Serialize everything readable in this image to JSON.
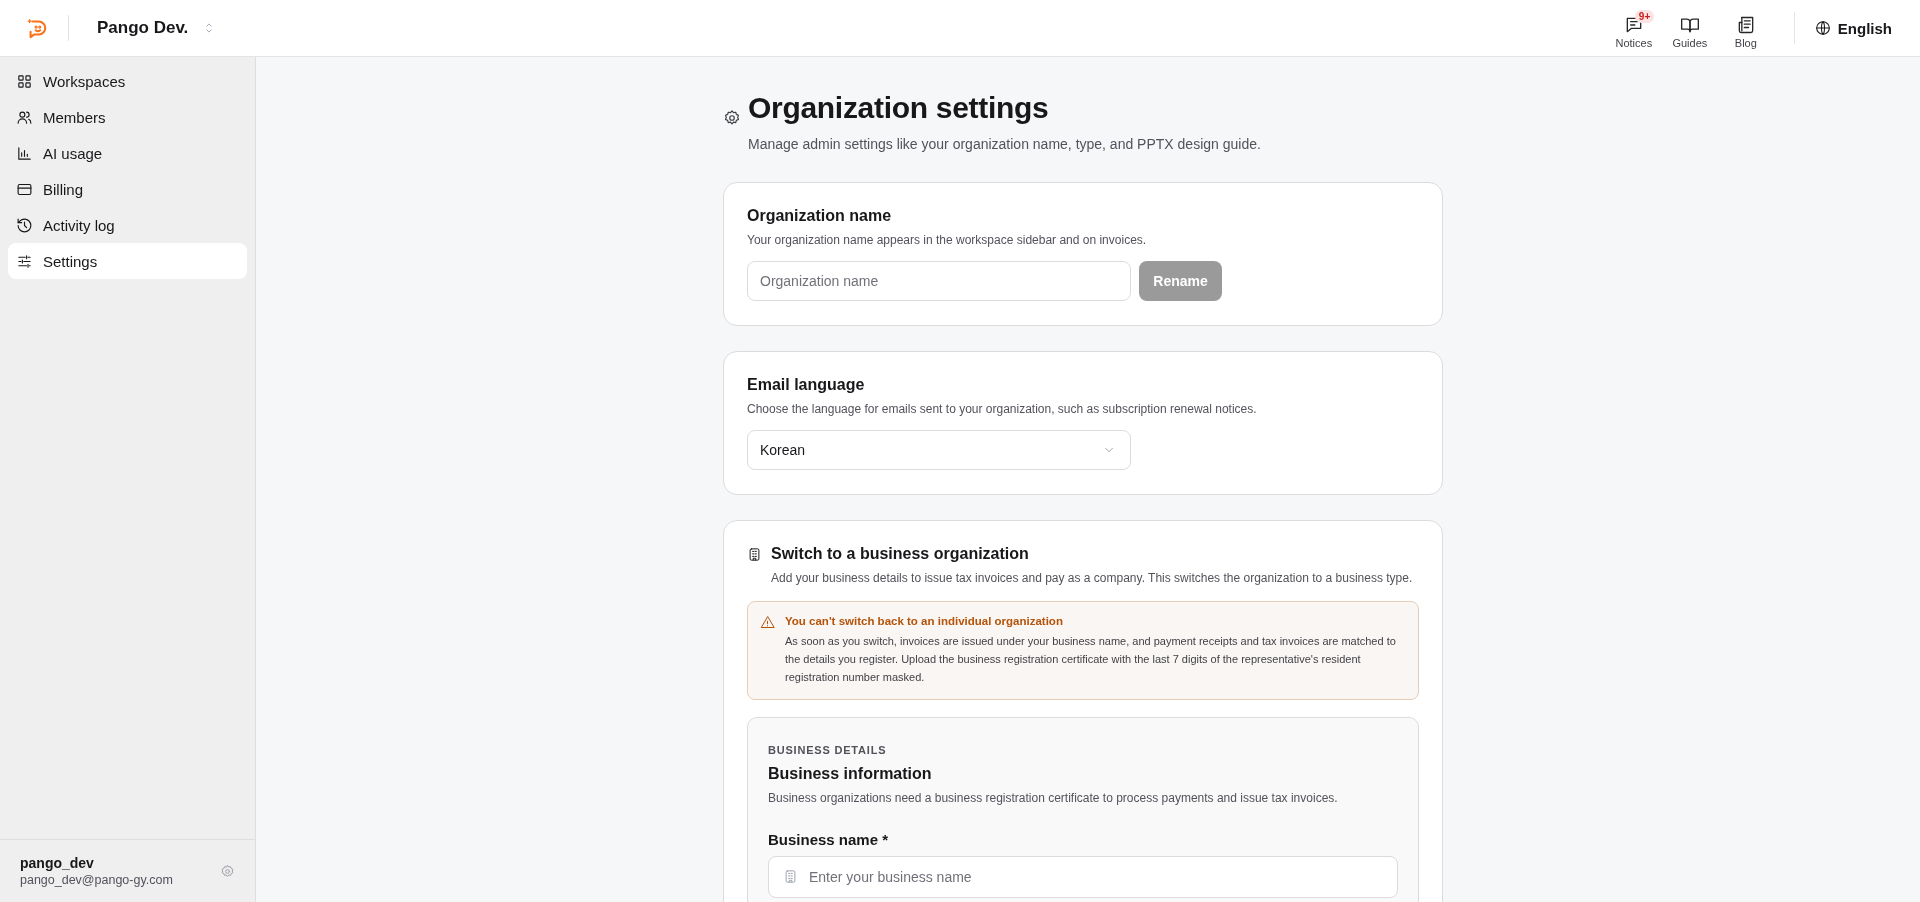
{
  "header": {
    "org_name": "Pango Dev.",
    "nav": [
      {
        "label": "Notices",
        "badge": "9+"
      },
      {
        "label": "Guides"
      },
      {
        "label": "Blog"
      }
    ],
    "language": "English"
  },
  "sidebar": {
    "items": [
      {
        "label": "Workspaces",
        "selected": false
      },
      {
        "label": "Members",
        "selected": false
      },
      {
        "label": "AI usage",
        "selected": false
      },
      {
        "label": "Billing",
        "selected": false
      },
      {
        "label": "Activity log",
        "selected": false
      },
      {
        "label": "Settings",
        "selected": true
      }
    ],
    "user": {
      "name": "pango_dev",
      "email": "pango_dev@pango-gy.com"
    }
  },
  "page": {
    "title": "Organization settings",
    "subtitle": "Manage admin settings like your organization name, type, and PPTX design guide."
  },
  "org_name_card": {
    "title": "Organization name",
    "description": "Your organization name appears in the workspace sidebar and on invoices.",
    "input": {
      "placeholder": "Organization name"
    },
    "button": {
      "label": "Rename",
      "disabled": true
    }
  },
  "email_language_card": {
    "title": "Email language",
    "description": "Choose the language for emails sent to your organization, such as subscription renewal notices.",
    "select": {
      "value": "Korean"
    }
  },
  "business_card": {
    "title": "Switch to a business organization",
    "description": "Add your business details to issue tax invoices and pay as a company. This switches the organization to a business type.",
    "warning": {
      "title": "You can't switch back to an individual organization",
      "body": "As soon as you switch, invoices are issued under your business name, and payment receipts and tax invoices are matched to the details you register. Upload the business registration certificate with the last 7 digits of the representative's resident registration number masked."
    },
    "details": {
      "eyebrow": "BUSINESS DETAILS",
      "title": "Business information",
      "description": "Business organizations need a business registration certificate to process payments and issue tax invoices.",
      "field": {
        "label": "Business name *",
        "placeholder": "Enter your business name"
      }
    }
  }
}
